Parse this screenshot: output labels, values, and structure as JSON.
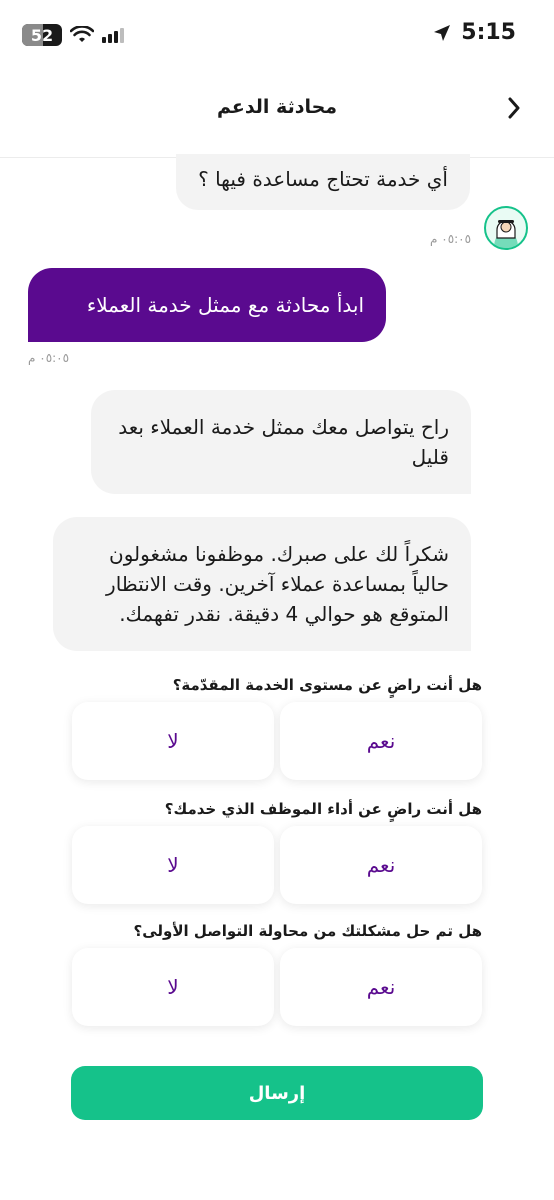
{
  "status_bar": {
    "time": "5:15",
    "battery": "52",
    "battery_level": 0.52
  },
  "header": {
    "title": "محادثة الدعم"
  },
  "messages": [
    {
      "type": "incoming",
      "text": "أي خدمة تحتاج مساعدة فيها ؟",
      "time": "٠٥:٠٥ م"
    },
    {
      "type": "outgoing",
      "text": "ابدأ محادثة مع ممثل خدمة العملاء",
      "time": "٠٥:٠٥ م"
    },
    {
      "type": "incoming",
      "text": "راح يتواصل معك ممثل خدمة العملاء بعد قليل"
    },
    {
      "type": "incoming",
      "text": "شكراً لك على صبرك. موظفونا مشغولون حالياً بمساعدة عملاء آخرين. وقت الانتظار المتوقع هو حوالي 4 دقيقة. نقدر تفهمك."
    }
  ],
  "survey": [
    {
      "question": "هل أنت راضٍ عن مستوى الخدمة المقدّمة؟",
      "yes": "نعم",
      "no": "لا"
    },
    {
      "question": "هل أنت راضٍ عن أداء الموظف الذي خدمك؟",
      "yes": "نعم",
      "no": "لا"
    },
    {
      "question": "هل تم حل مشكلتك من محاولة التواصل الأولى؟",
      "yes": "نعم",
      "no": "لا"
    }
  ],
  "send_button": {
    "label": "إرسال"
  },
  "colors": {
    "accent_green": "#15c28a",
    "accent_purple": "#5a0a8f",
    "bubble_gray": "#f3f3f3"
  }
}
